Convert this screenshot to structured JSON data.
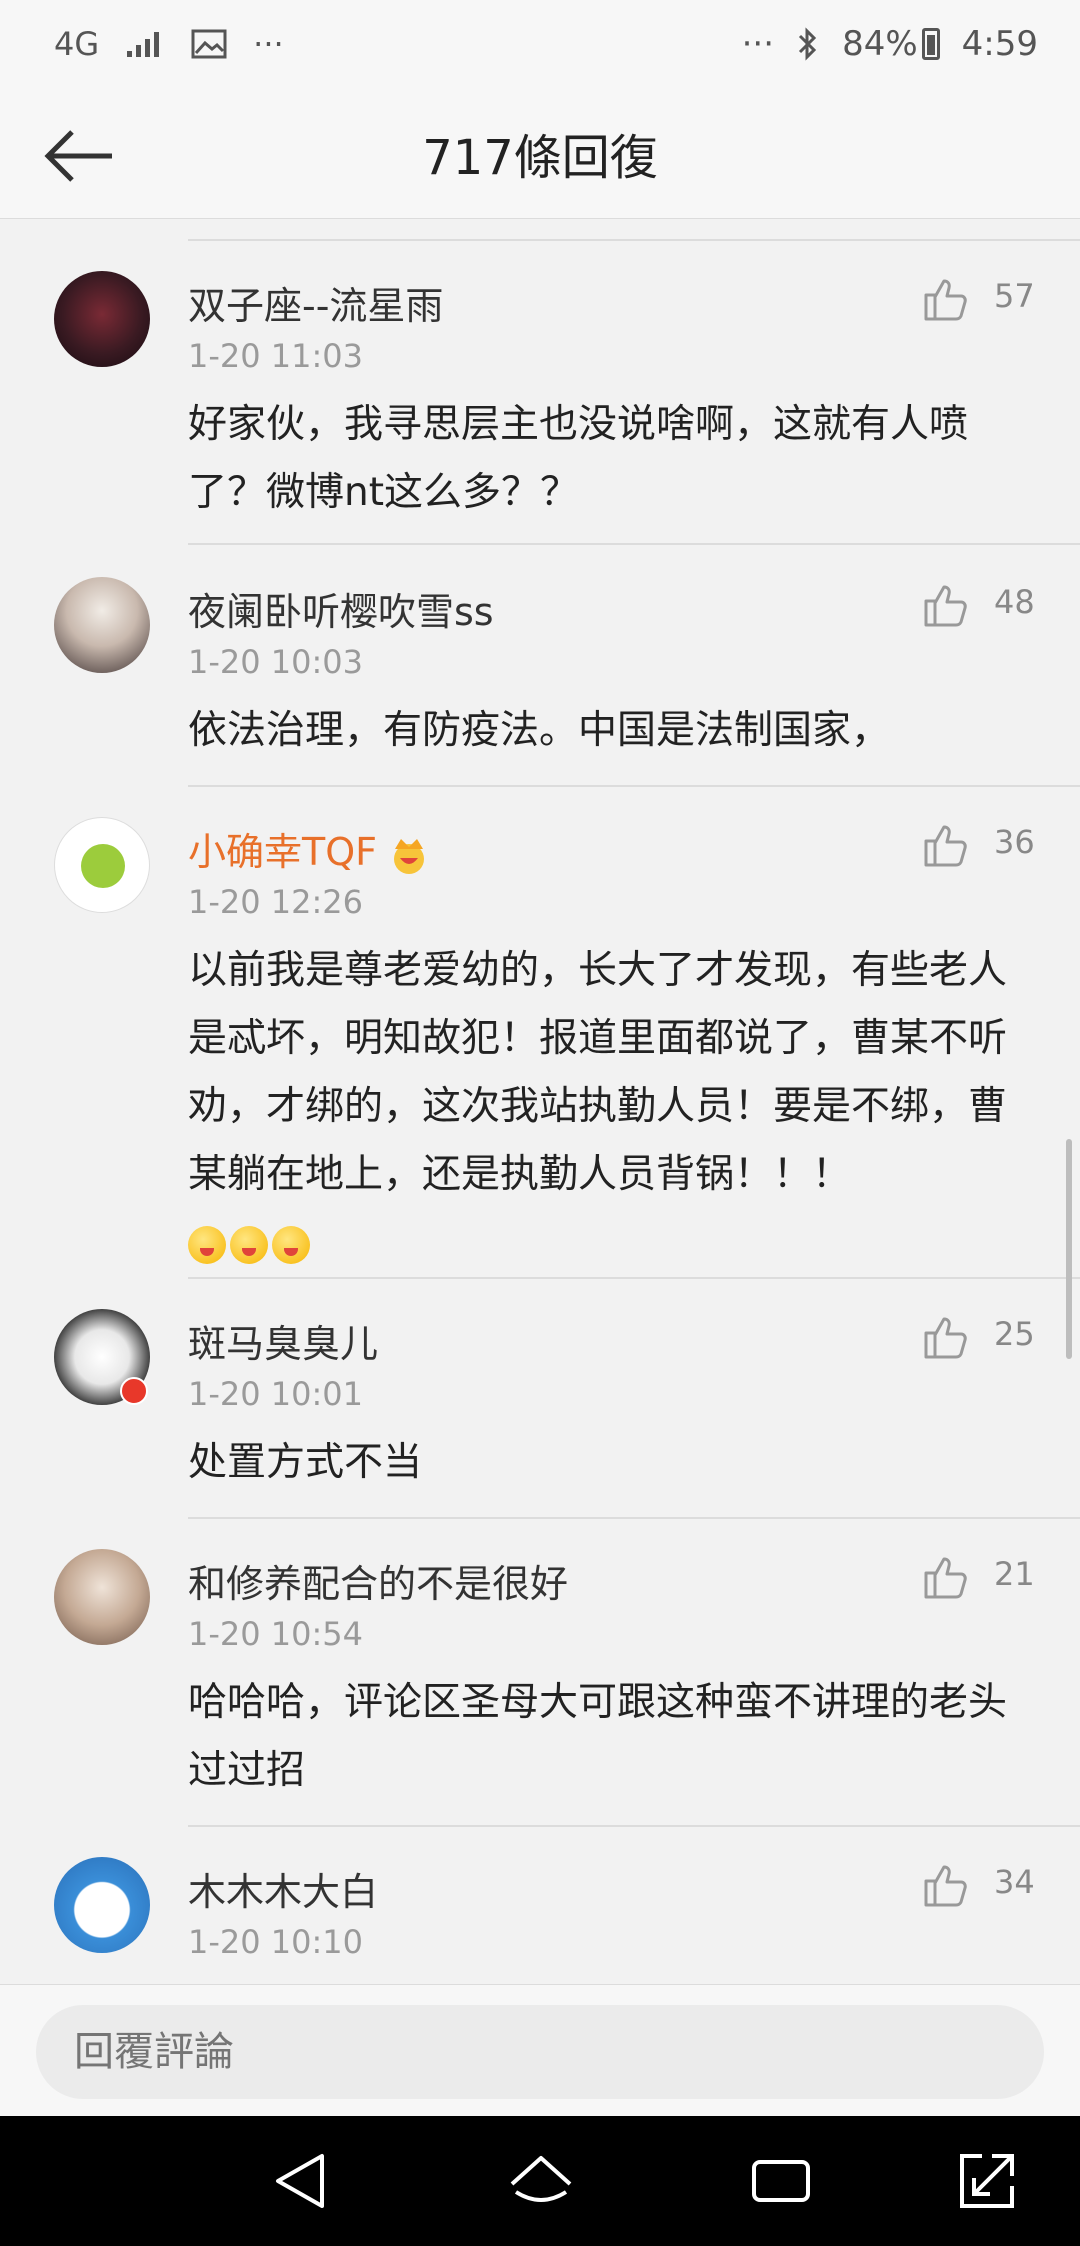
{
  "status_bar": {
    "network": "4G",
    "more": "···",
    "battery": "84%",
    "time": "4:59"
  },
  "header": {
    "title": "717條回復"
  },
  "colors": {
    "vip_name": "#e8702a",
    "text": "#222222",
    "meta": "#9a9a9a"
  },
  "comments": [
    {
      "user": "双子座--流星雨",
      "time": "1-20 11:03",
      "likes": "57",
      "content": "好家伙，我寻思层主也没说啥啊，这就有人喷了？微博nt这么多？？"
    },
    {
      "user": "夜阑卧听樱吹雪ss",
      "time": "1-20 10:03",
      "likes": "48",
      "content": "依法治理，有防疫法。中国是法制国家，"
    },
    {
      "user": "小确幸TQF",
      "time": "1-20 12:26",
      "likes": "36",
      "content": "以前我是尊老爱幼的，长大了才发现，有些老人是忒坏，明知故犯！报道里面都说了，曹某不听劝，才绑的，这次我站执勤人员！要是不绑，曹某躺在地上，还是执勤人员背锅！！！"
    },
    {
      "user": "斑马臭臭儿",
      "time": "1-20 10:01",
      "likes": "25",
      "content": "处置方式不当"
    },
    {
      "user": "和修养配合的不是很好",
      "time": "1-20 10:54",
      "likes": "21",
      "content": "哈哈哈，评论区圣母大可跟这种蛮不讲理的老头过过招"
    },
    {
      "user": "木木木大白",
      "time": "1-20 10:10",
      "likes": "34",
      "content": ""
    }
  ],
  "reply_bar": {
    "placeholder": "回覆評論"
  },
  "icons": {
    "back": "back-arrow-icon",
    "like": "thumbs-up-icon",
    "nav": [
      "back-triangle-icon",
      "home-icon",
      "recents-icon",
      "expand-icon"
    ]
  }
}
